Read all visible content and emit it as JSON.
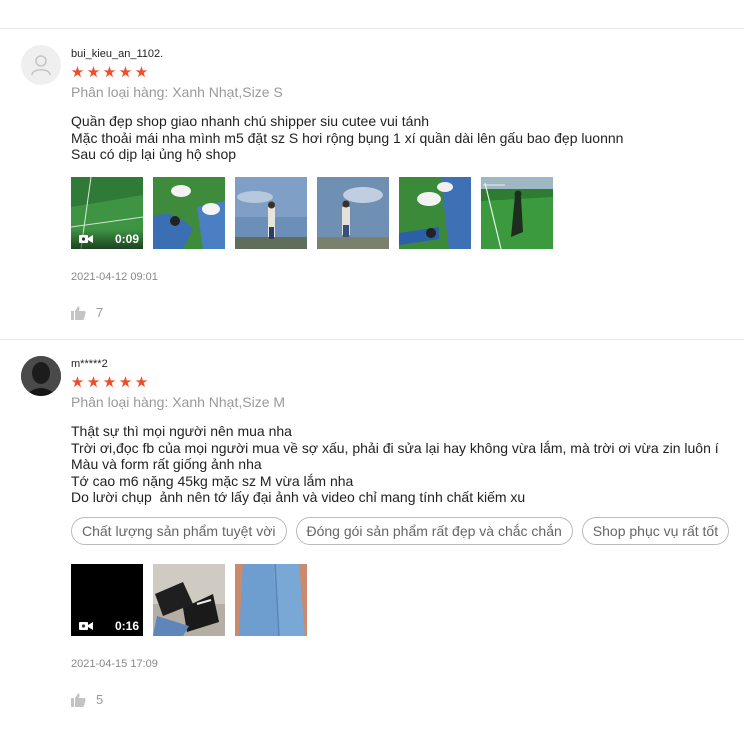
{
  "reviews": [
    {
      "username": "bui_kieu_an_1102.",
      "stars": [
        "★",
        "★",
        "★",
        "★",
        "★"
      ],
      "variation": "Phân loại hàng: Xanh Nhạt,Size S",
      "comment_lines": [
        "Quần đẹp shop giao nhanh chú shipper siu cutee vui tánh",
        "Mặc thoải mái nha mình m5 đặt sz S hơi rộng bụng 1 xí quần dài lên gấu bao đẹp luonnn",
        "Sau có dịp lại ủng hộ shop"
      ],
      "video_duration": "0:09",
      "datetime": "2021-04-12 09:01",
      "likes": "7"
    },
    {
      "username": "m*****2",
      "stars": [
        "★",
        "★",
        "★",
        "★",
        "★"
      ],
      "variation": "Phân loại hàng: Xanh Nhạt,Size M",
      "comment_lines": [
        "Thật sự thì mọi người nên mua nha",
        "Trời ơi,đọc fb của mọi người mua về sợ xấu, phải đi sửa lại hay không vừa lắm, mà trời ơi vừa zin luôn í",
        "Màu và form rất giống ảnh nha",
        "Tớ cao m6 nặng 45kg mặc sz M vừa lắm nha",
        "Do lười chụp  ảnh nên tớ lấy đại ảnh và video chỉ mang tính chất kiếm xu"
      ],
      "tags": [
        "Chất lượng sản phẩm tuyệt vời",
        "Đóng gói sản phẩm rất đẹp và chắc chắn",
        "Shop phục vụ rất tốt"
      ],
      "video_duration": "0:16",
      "datetime": "2021-04-15 17:09",
      "likes": "5"
    }
  ],
  "colors": {
    "star": "#ee4d2d",
    "muted": "#9a9a9a",
    "divider": "#e8e8e8"
  }
}
